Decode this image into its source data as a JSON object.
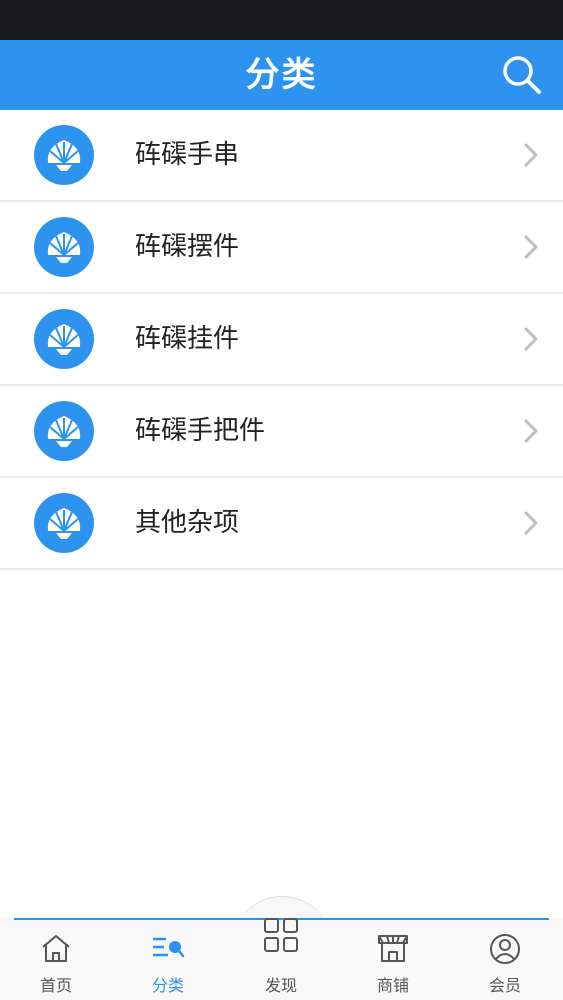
{
  "header": {
    "title": "分类",
    "search_icon": "search-icon"
  },
  "categories": [
    {
      "label": "砗磲手串",
      "icon": "shell-icon"
    },
    {
      "label": "砗磲摆件",
      "icon": "shell-icon"
    },
    {
      "label": "砗磲挂件",
      "icon": "shell-icon"
    },
    {
      "label": "砗磲手把件",
      "icon": "shell-icon"
    },
    {
      "label": "其他杂项",
      "icon": "shell-icon"
    }
  ],
  "tabbar": {
    "tabs": [
      {
        "label": "首页",
        "icon": "home-icon"
      },
      {
        "label": "分类",
        "icon": "category-icon",
        "active": true
      },
      {
        "label": "发现",
        "icon": "grid-icon"
      },
      {
        "label": "商铺",
        "icon": "store-icon"
      },
      {
        "label": "会员",
        "icon": "user-icon"
      }
    ]
  },
  "colors": {
    "brand": "#2e93ee",
    "status_bar": "#1b1b1d"
  }
}
